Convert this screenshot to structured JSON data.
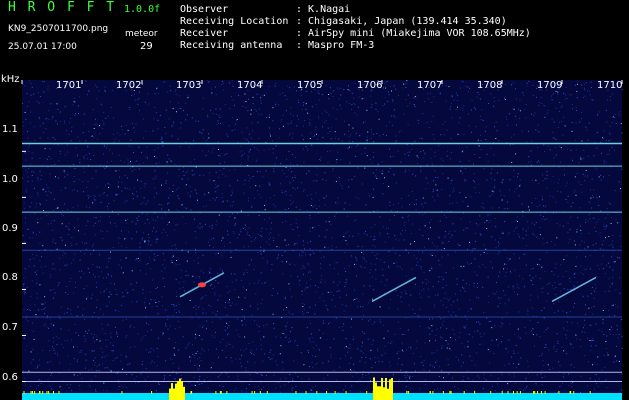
{
  "header": {
    "app_name": "H R O F F T",
    "version": "1.0.0f",
    "filename": "KN9_2507011700.png",
    "datetime": "25.07.01 17:00",
    "meteor_label": "meteor",
    "meteor_count": "29",
    "info_rows": [
      {
        "key": "Observer",
        "value": ": K.Nagai"
      },
      {
        "key": "Receiving Location",
        "value": ": Chigasaki, Japan (139.414 35.340)"
      },
      {
        "key": "Receiver",
        "value": ": AirSpy mini (Miakejima VOR 108.65MHz)"
      },
      {
        "key": "Receiving antenna",
        "value": ": Maspro FM-3"
      }
    ]
  },
  "chart_data": {
    "type": "heatmap",
    "ylabel": "kHz",
    "y_ticks": [
      "1.1",
      "1.0",
      "0.9",
      "0.8",
      "0.7",
      "0.6"
    ],
    "x_ticks": [
      "1701",
      "1702",
      "1703",
      "1704",
      "1705",
      "1706",
      "1707",
      "1708",
      "1709",
      "1710"
    ],
    "ylim": [
      0.575,
      1.255
    ],
    "carrier_lines_khz": [
      1.117,
      1.068,
      0.968,
      0.62,
      0.6
    ],
    "meteor_echoes": [
      {
        "minute": 1703.0,
        "khz": 0.81
      },
      {
        "minute": 1706.2,
        "khz": 0.8
      },
      {
        "minute": 1709.2,
        "khz": 0.8
      }
    ],
    "colors": {
      "background": "#04083c",
      "noise": "#2a4fd8",
      "carrier": "#78e8f0",
      "echo": "#ff4040",
      "baseline": "#00e0ff",
      "activity": "#ffff00"
    }
  }
}
